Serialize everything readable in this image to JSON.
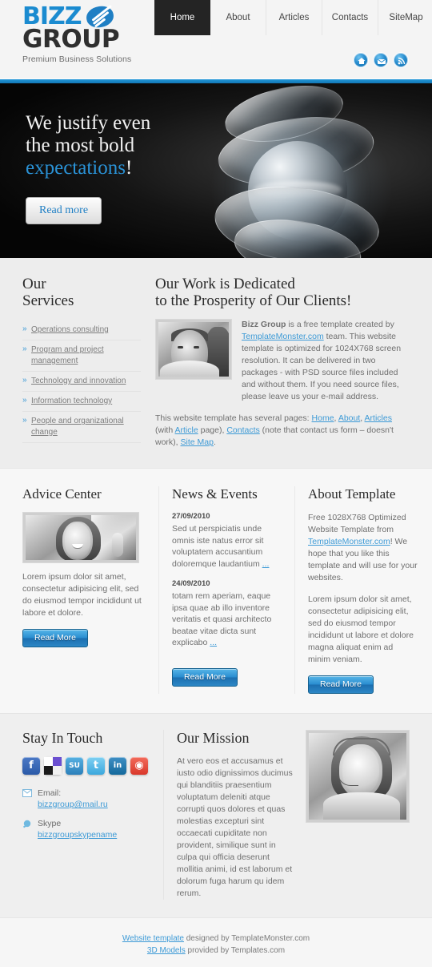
{
  "header": {
    "logo": {
      "line1": "BIZZ",
      "line2": "GROUP",
      "tagline": "Premium Business Solutions"
    },
    "nav": [
      {
        "label": "Home",
        "active": true
      },
      {
        "label": "About",
        "active": false
      },
      {
        "label": "Articles",
        "active": false
      },
      {
        "label": "Contacts",
        "active": false
      },
      {
        "label": "SiteMap",
        "active": false
      }
    ],
    "quick_icons": [
      "home-icon",
      "mail-icon",
      "rss-icon"
    ],
    "accent_color": "#1b8bd0"
  },
  "hero": {
    "line1": "We justify even",
    "line2": "the most bold",
    "line3_accent": "expectations",
    "line3_exclaim": "!",
    "button": "Read more"
  },
  "services": {
    "title_line1": "Our",
    "title_line2": "Services",
    "items": [
      "Operations consulting",
      "Program and project management",
      "Technology and innovation",
      "Information technology",
      "People and organizational change"
    ]
  },
  "work": {
    "title_line1": "Our Work is Dedicated",
    "title_line2": "to the Prosperity of Our Clients!",
    "photo_alt": "businessman-portrait",
    "paragraph": {
      "strong": "Bizz Group",
      "part1": " is a free template created by ",
      "link": "TemplateMonster.com",
      "part2": " team. This website template is optimized for 1024X768 screen resolution. It can be delivered in two packages - with PSD source files included and without them. If you need source files, please leave us your e-mail address."
    },
    "links_line": {
      "intro": "This website template has several pages: ",
      "l1": "Home",
      "sep1": ", ",
      "l2": "About",
      "sep2": ", ",
      "l3": "Articles",
      "mid1": " (with ",
      "l4": "Article",
      "mid2": " page), ",
      "l5": "Contacts",
      "mid3": " (note that contact us form – doesn't work), ",
      "l6": "Site Map",
      "end": "."
    }
  },
  "three_columns": {
    "advice": {
      "title": "Advice Center",
      "photo_alt": "smiling-woman-portrait",
      "text": "Lorem ipsum dolor sit amet, consectetur adipisicing elit, sed do eiusmod tempor incididunt ut labore et dolore.",
      "button": "Read More"
    },
    "news": {
      "title": "News & Events",
      "items": [
        {
          "date": "27/09/2010",
          "text": "Sed ut perspiciatis unde omnis iste natus error sit voluptatem accusantium doloremque laudantium"
        },
        {
          "date": "24/09/2010",
          "text": "totam rem aperiam, eaque ipsa quae ab illo inventore veritatis et quasi architecto beatae vitae dicta sunt explicabo"
        }
      ],
      "more_marker": "...",
      "button": "Read More"
    },
    "about": {
      "title": "About Template",
      "p1_part1": "Free 1028X768 Optimized Website Template from ",
      "p1_link": "TemplateMonster.com",
      "p1_part2": "! We hope that you like this template and will use for your websites.",
      "p2": "Lorem ipsum dolor sit amet, consectetur adipisicing elit, sed do eiusmod tempor incididunt ut labore et dolore magna aliquat enim ad minim veniam.",
      "button": "Read More"
    }
  },
  "touch": {
    "title": "Stay In Touch",
    "social": [
      {
        "name": "facebook-icon",
        "glyph": "f"
      },
      {
        "name": "delicious-icon",
        "glyph": ""
      },
      {
        "name": "stumbleupon-icon",
        "glyph": "SU"
      },
      {
        "name": "twitter-icon",
        "glyph": "t"
      },
      {
        "name": "linkedin-icon",
        "glyph": "in"
      },
      {
        "name": "reddit-icon",
        "glyph": "◉"
      }
    ],
    "email_label": "Email:",
    "email_value": "bizzgroup@mail.ru",
    "skype_label": "Skype",
    "skype_value": "bizzgroupskypename"
  },
  "mission": {
    "title": "Our Mission",
    "text": "At vero eos et accusamus et iusto odio dignissimos ducimus qui blanditiis praesentium voluptatum deleniti atque corrupti quos dolores et quas molestias excepturi sint occaecati cupiditate non provident, similique sunt in culpa qui officia deserunt mollitia animi, id est laborum et dolorum fuga harum qu idem rerum.",
    "photo_alt": "headset-operator-portrait"
  },
  "footer": {
    "line1_link": "Website template",
    "line1_rest": " designed by TemplateMonster.com",
    "line2_link": "3D Models",
    "line2_rest": " provided by Templates.com"
  }
}
